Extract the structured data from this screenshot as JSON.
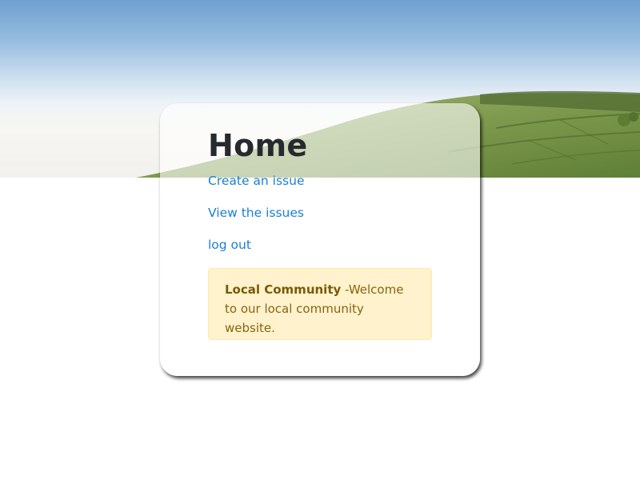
{
  "page": {
    "title": "Home"
  },
  "nav": {
    "links": [
      {
        "label": "Create an issue"
      },
      {
        "label": "View the issues"
      },
      {
        "label": "log out"
      }
    ]
  },
  "alert": {
    "heading": "Local Community",
    "message": " -Welcome to our local community website."
  },
  "colors": {
    "link": "#1a7fd4",
    "alert_background": "#fff2cc",
    "alert_text": "#866511",
    "title_text": "#262a2e"
  }
}
